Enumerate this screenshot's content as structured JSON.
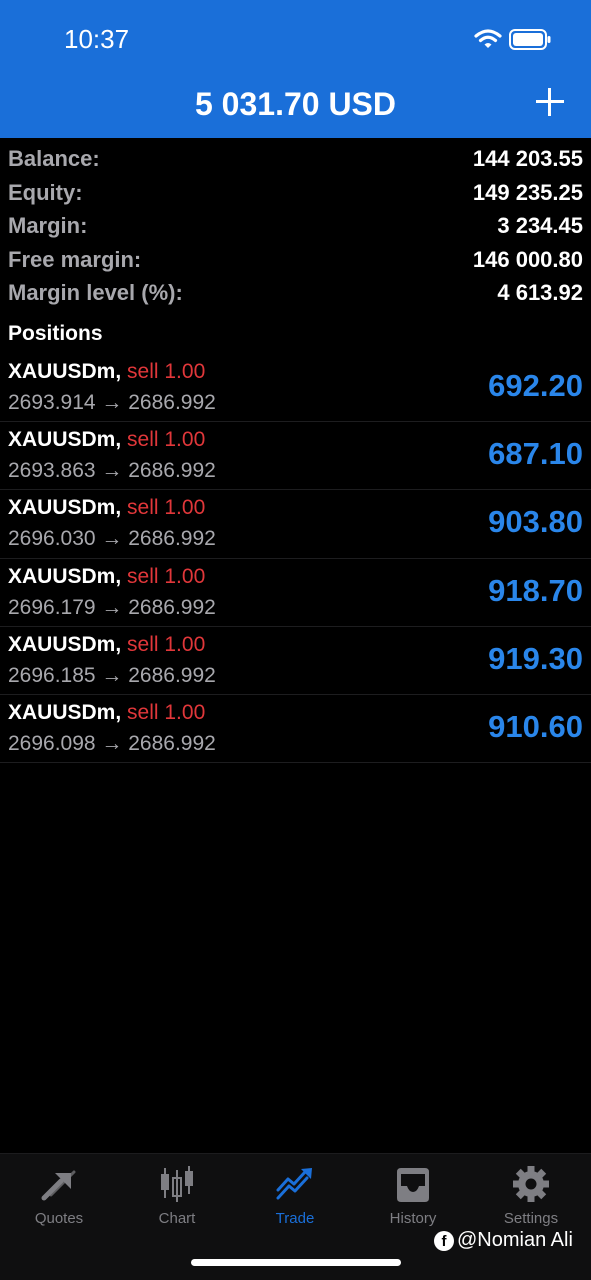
{
  "status_bar": {
    "time": "10:37"
  },
  "header": {
    "title": "5 031.70 USD"
  },
  "summary": [
    {
      "label": "Balance:",
      "value": "144 203.55"
    },
    {
      "label": "Equity:",
      "value": "149 235.25"
    },
    {
      "label": "Margin:",
      "value": "3 234.45"
    },
    {
      "label": "Free margin:",
      "value": "146 000.80"
    },
    {
      "label": "Margin level (%):",
      "value": "4 613.92"
    }
  ],
  "positions_title": "Positions",
  "positions": [
    {
      "symbol": "XAUUSDm,",
      "side": "sell 1.00",
      "prices": "2693.914 → 2686.992",
      "profit": "692.20"
    },
    {
      "symbol": "XAUUSDm,",
      "side": "sell 1.00",
      "prices": "2693.863 → 2686.992",
      "profit": "687.10"
    },
    {
      "symbol": "XAUUSDm,",
      "side": "sell 1.00",
      "prices": "2696.030 → 2686.992",
      "profit": "903.80"
    },
    {
      "symbol": "XAUUSDm,",
      "side": "sell 1.00",
      "prices": "2696.179 → 2686.992",
      "profit": "918.70"
    },
    {
      "symbol": "XAUUSDm,",
      "side": "sell 1.00",
      "prices": "2696.185 → 2686.992",
      "profit": "919.30"
    },
    {
      "symbol": "XAUUSDm,",
      "side": "sell 1.00",
      "prices": "2696.098 → 2686.992",
      "profit": "910.60"
    }
  ],
  "tabs": [
    {
      "label": "Quotes",
      "icon": "quotes-icon"
    },
    {
      "label": "Chart",
      "icon": "chart-icon"
    },
    {
      "label": "Trade",
      "icon": "trade-icon",
      "active": true
    },
    {
      "label": "History",
      "icon": "history-icon"
    },
    {
      "label": "Settings",
      "icon": "settings-icon"
    }
  ],
  "watermark": {
    "fb_glyph": "f",
    "text": "@Nomian Ali"
  },
  "colors": {
    "header_bg": "#1a6fd9",
    "profit": "#2a86ea",
    "sell": "#e0373a",
    "label_gray": "#a8a8ad"
  }
}
